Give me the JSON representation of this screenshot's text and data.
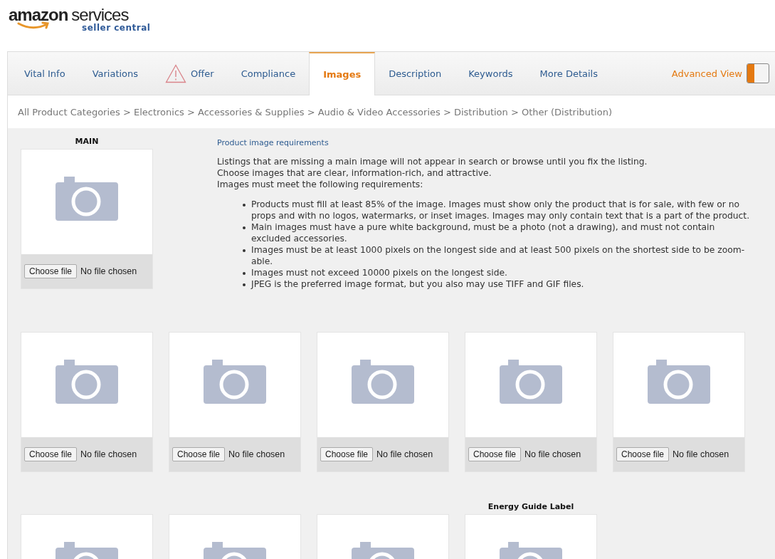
{
  "logo": {
    "brand": "amazon",
    "product": "services",
    "subtitle": "seller central"
  },
  "tabs": [
    {
      "label": "Vital Info",
      "selected": false,
      "warning": false
    },
    {
      "label": "Variations",
      "selected": false,
      "warning": false
    },
    {
      "label": "Offer",
      "selected": false,
      "warning": true
    },
    {
      "label": "Compliance",
      "selected": false,
      "warning": false
    },
    {
      "label": "Images",
      "selected": true,
      "warning": false
    },
    {
      "label": "Description",
      "selected": false,
      "warning": false
    },
    {
      "label": "Keywords",
      "selected": false,
      "warning": false
    },
    {
      "label": "More Details",
      "selected": false,
      "warning": false
    }
  ],
  "advanced_view": {
    "label": "Advanced View",
    "on": true
  },
  "breadcrumb": "All Product Categories > Electronics > Accessories & Supplies > Audio & Video Accessories > Distribution > Other (Distribution)",
  "main_slot": {
    "label": "MAIN",
    "button": "Choose file",
    "status": "No file chosen"
  },
  "requirements": {
    "link": "Product image requirements",
    "intro": [
      "Listings that are missing a main image will not appear in search or browse until you fix the listing.",
      "Choose images that are clear, information-rich, and attractive.",
      "Images must meet the following requirements:"
    ],
    "items": [
      "Products must fill at least 85% of the image. Images must show only the product that is for sale, with few or no props and with no logos, watermarks, or inset images. Images may only contain text that is a part of the product.",
      "Main images must have a pure white background, must be a photo (not a drawing), and must not contain excluded accessories.",
      "Images must be at least 1000 pixels on the longest side and at least 500 pixels on the shortest side to be zoom-able.",
      "Images must not exceed 10000 pixels on the longest side.",
      "JPEG is the preferred image format, but you also may use TIFF and GIF files."
    ]
  },
  "slot_rows": [
    [
      {
        "button": "Choose file",
        "status": "No file chosen"
      },
      {
        "button": "Choose file",
        "status": "No file chosen"
      },
      {
        "button": "Choose file",
        "status": "No file chosen"
      },
      {
        "button": "Choose file",
        "status": "No file chosen"
      },
      {
        "button": "Choose file",
        "status": "No file chosen"
      }
    ],
    [
      {},
      {},
      {},
      {
        "label": "Energy Guide Label"
      }
    ]
  ]
}
